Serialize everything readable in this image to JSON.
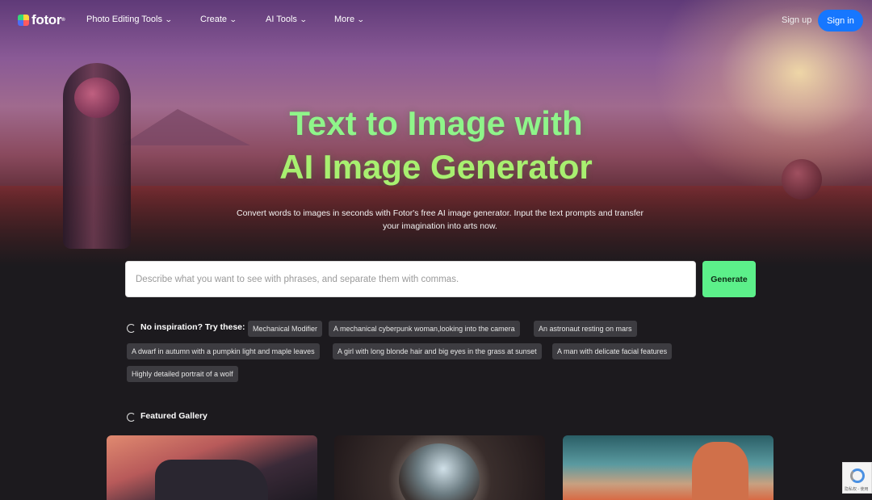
{
  "nav": {
    "logo": "fotor",
    "logo_mark": "®",
    "items": [
      {
        "label": "Photo Editing Tools"
      },
      {
        "label": "Create"
      },
      {
        "label": "AI Tools"
      },
      {
        "label": "More"
      }
    ],
    "sign_up": "Sign up",
    "sign_in": "Sign in"
  },
  "hero": {
    "title_line1": "Text to Image with",
    "title_line2": "AI Image Generator",
    "subtitle": "Convert words to images in seconds with Fotor's free AI image generator. Input the text prompts and transfer your imagination into arts now.",
    "prompt_placeholder": "Describe what you want to see with phrases, and separate them with commas.",
    "prompt_value": "",
    "generate_label": "Generate"
  },
  "inspiration": {
    "label": "No inspiration? Try these:",
    "chips": [
      "Mechanical Modifier",
      "A mechanical cyberpunk woman,looking into the camera",
      "An astronaut resting on mars",
      "A dwarf in autumn with a pumpkin light and maple leaves",
      "A girl with long blonde hair and big eyes in the grass at sunset",
      "A man with delicate facial features",
      "Highly detailed portrait of a wolf"
    ]
  },
  "gallery": {
    "label": "Featured Gallery"
  },
  "recaptcha": {
    "text": "隐私权 - 使用"
  },
  "colors": {
    "title_green": "#8ff58a",
    "generate_bg": "#5cf08a",
    "sign_in_bg": "#1677ff",
    "page_bg": "#1c1a1e"
  }
}
